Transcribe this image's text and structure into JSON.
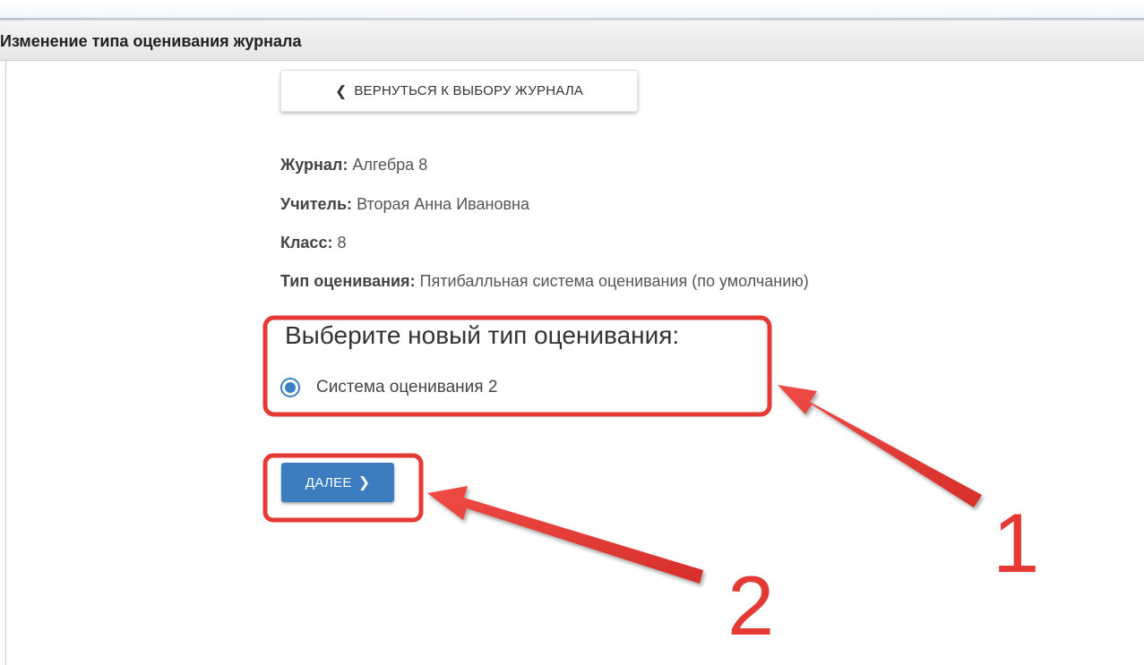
{
  "panel": {
    "title": "Изменение типа оценивания журнала"
  },
  "back_button": {
    "icon": "chevron-left-icon",
    "icon_glyph": "❮",
    "label": "ВЕРНУТЬСЯ К ВЫБОРУ ЖУРНАЛА"
  },
  "details": {
    "journal": {
      "label": "Журнал:",
      "value": "Алгебра 8"
    },
    "teacher": {
      "label": "Учитель:",
      "value": "Вторая Анна Ивановна"
    },
    "class": {
      "label": "Класс:",
      "value": "8"
    },
    "grading_type": {
      "label": "Тип оценивания:",
      "value": "Пятибалльная система оценивания (по умолчанию)"
    }
  },
  "choose": {
    "title": "Выберите новый тип оценивания:",
    "options": [
      {
        "label": "Система оценивания 2",
        "selected": true
      }
    ]
  },
  "next_button": {
    "label": "ДАЛЕЕ",
    "icon": "chevron-right-icon",
    "icon_glyph": "❯"
  },
  "annotations": {
    "labels": [
      "1",
      "2"
    ],
    "color": "#e53935"
  },
  "colors": {
    "accent": "#3b7dbe",
    "annotation": "#e53935"
  }
}
